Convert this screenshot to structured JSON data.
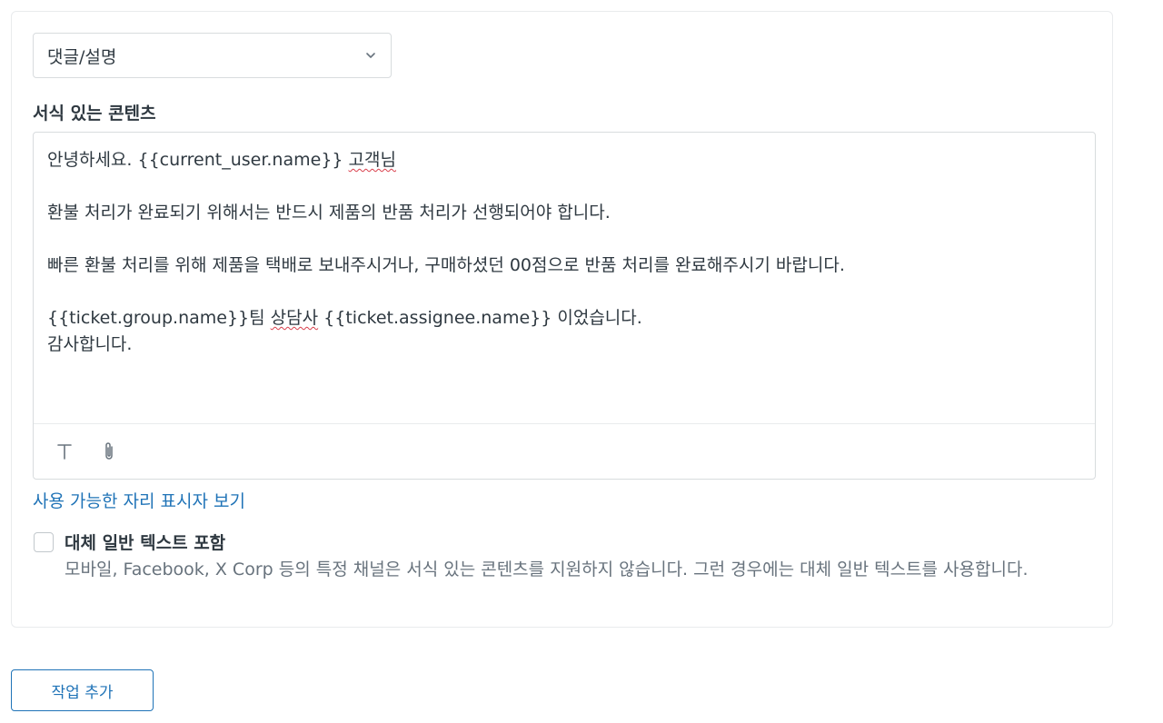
{
  "select": {
    "value": "댓글/설명"
  },
  "rich_content": {
    "label": "서식 있는 콘텐츠",
    "lines": {
      "l1_pre": "안녕하세요. {{current_user.name}} ",
      "l1_spell": "고객님",
      "l2": "환불 처리가 완료되기 위해서는 반드시 제품의 반품 처리가 선행되어야 합니다.",
      "l3": "빠른 환불 처리를 위해 제품을 택배로 보내주시거나, 구매하셨던 00점으로 반품 처리를 완료해주시기 바랍니다.",
      "l4_pre": "{{ticket.group.name}}팀 ",
      "l4_spell": "상담사",
      "l4_post": " {{ticket.assignee.name}} 이었습니다.",
      "l5": "감사합니다."
    },
    "toolbar": {
      "text_format_icon": "T",
      "attach_icon": "paperclip-icon"
    }
  },
  "placeholders_link": "사용 가능한 자리 표시자 보기",
  "fallback": {
    "checked": false,
    "label": "대체 일반 텍스트 포함",
    "hint": "모바일, Facebook, X Corp 등의 특정 채널은 서식 있는 콘텐츠를 지원하지 않습니다. 그런 경우에는 대체 일반 텍스트를 사용합니다."
  },
  "add_action_button": "작업 추가",
  "colors": {
    "accent": "#1f73b7",
    "text": "#2f3941",
    "muted": "#68737d",
    "border": "#d8dcde"
  }
}
